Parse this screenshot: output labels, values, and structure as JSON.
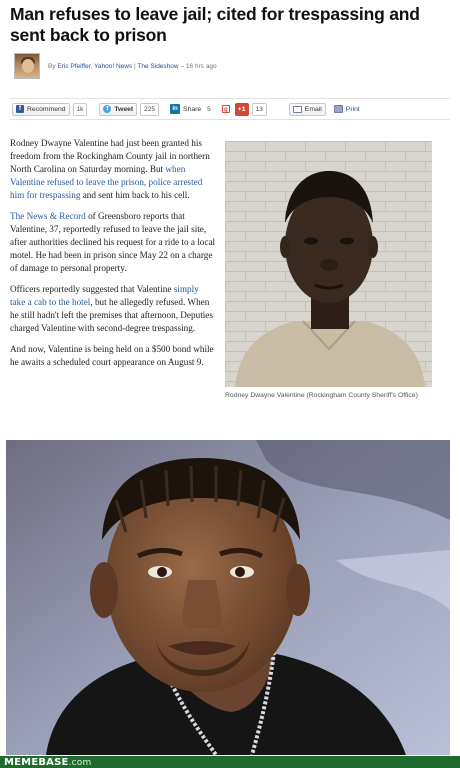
{
  "headline": "Man refuses to leave jail; cited for trespassing and sent back to prison",
  "byline": {
    "prefix": "By",
    "author": "Eric Pfeiffer",
    "outlet": "Yahoo! News",
    "section": "The Sideshow",
    "time": "– 16 hrs ago"
  },
  "share_bar": {
    "recommend": {
      "label": "Recommend",
      "count": "1k",
      "icon": "facebook-icon"
    },
    "tweet": {
      "label": "Tweet",
      "count": "225",
      "icon": "twitter-icon"
    },
    "linkedin": {
      "label": "Share",
      "count": "5",
      "icon": "linkedin-icon"
    },
    "gplus": {
      "label": "+1",
      "count": "13",
      "icon": "google-plus-icon"
    },
    "email": {
      "label": "Email",
      "icon": "mail-icon"
    },
    "print": {
      "label": "Print",
      "icon": "printer-icon"
    }
  },
  "article": {
    "p1_a": "Rodney Dwayne Valentine had just been granted his freedom from the Rockingham County jail in northern North Carolina on Saturday morning. But ",
    "p1_link": "when Valentine refused to leave the prison, police arrested him for trespassing",
    "p1_b": " and sent him back to his cell.",
    "p2_link": "The News & Record",
    "p2_b": " of Greensboro reports that Valentine, 37, reportedly refused to leave the jail site, after authorities declined his request for a ride to a local motel. He had been in prison since May 22 on a charge of damage to personal property.",
    "p3_a": "Officers reportedly suggested that Valentine ",
    "p3_link": "simply take a cab to the hotel",
    "p3_b": ", but he allegedly refused. When he still hadn't left the premises that afternoon, Deputies charged Valentine with second-degree trespassing.",
    "p4": "And now, Valentine is being held on a $500 bond while he awaits a scheduled court appearance on August 9."
  },
  "mugshot_caption": "Rodney Dwayne Valentine (Rockingham County Sheriff's Office)",
  "footer": {
    "brand": "MEMEBASE",
    "tld": ".com"
  },
  "colors": {
    "link": "#2a5aa0",
    "footer_bg": "#1f6b2e",
    "mug_wall": "#d8d6cf"
  }
}
